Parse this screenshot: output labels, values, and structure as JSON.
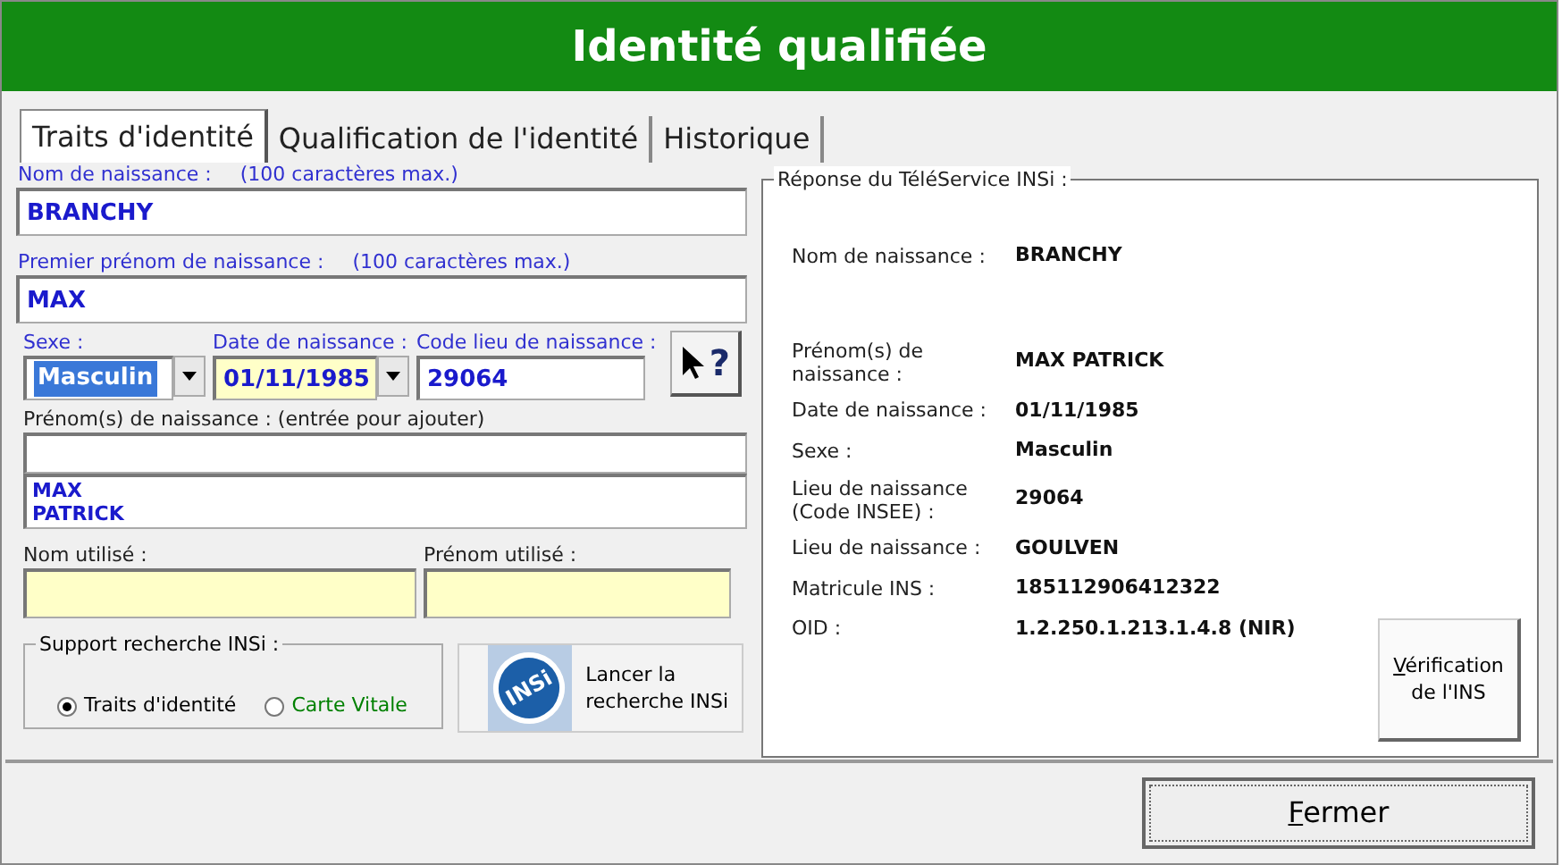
{
  "window": {
    "title": "Identité qualifiée"
  },
  "tabs": [
    {
      "label": "Traits d'identité",
      "selected": true
    },
    {
      "label": "Qualification de l'identité",
      "selected": false
    },
    {
      "label": "Historique",
      "selected": false
    }
  ],
  "birth_name": {
    "label": "Nom de naissance :",
    "hint": "(100 caractères max.)",
    "value": "BRANCHY"
  },
  "first_name": {
    "label": "Premier prénom de naissance :",
    "hint": "(100 caractères max.)",
    "value": "MAX"
  },
  "sex": {
    "label": "Sexe :",
    "value": "Masculin",
    "text_selected": true
  },
  "birth_date": {
    "label": "Date de naissance :",
    "value": "01/11/1985"
  },
  "birth_place_code": {
    "label": "Code lieu de naissance :",
    "value": "29064"
  },
  "help_button": {
    "symbol": "?"
  },
  "given_names": {
    "label": "Prénom(s) de naissance : (entrée pour ajouter)",
    "items": [
      "MAX",
      "PATRICK"
    ]
  },
  "used_name": {
    "label": "Nom utilisé :"
  },
  "used_first_name": {
    "label": "Prénom utilisé :"
  },
  "search_support": {
    "legend": "Support recherche INSi :",
    "options": [
      {
        "label": "Traits d'identité",
        "selected": true,
        "color": "#000000"
      },
      {
        "label": "Carte Vitale",
        "selected": false,
        "color": "#008000"
      }
    ]
  },
  "search_button": {
    "logo_text": "INSi",
    "label": "Lancer la recherche INSi"
  },
  "response": {
    "legend": "Réponse du TéléService INSi :",
    "rows": [
      {
        "label": "Nom de naissance :",
        "value": "BRANCHY"
      },
      {
        "label": "Prénom(s) de naissance :",
        "value": "MAX PATRICK"
      },
      {
        "label": "Date de naissance :",
        "value": "01/11/1985"
      },
      {
        "label": "Sexe :",
        "value": "Masculin"
      },
      {
        "label": "Lieu de naissance (Code INSEE) :",
        "value": "29064"
      },
      {
        "label": "Lieu de naissance :",
        "value": "GOULVEN"
      },
      {
        "label": "Matricule INS :",
        "value": "185112906412322"
      },
      {
        "label": "OID :",
        "value": "1.2.250.1.213.1.4.8 (NIR)"
      }
    ],
    "verify_button": {
      "label": "Vérification de l'INS",
      "mnemonic": true
    }
  },
  "close_button": {
    "label": "Fermer",
    "mnemonic": true
  }
}
